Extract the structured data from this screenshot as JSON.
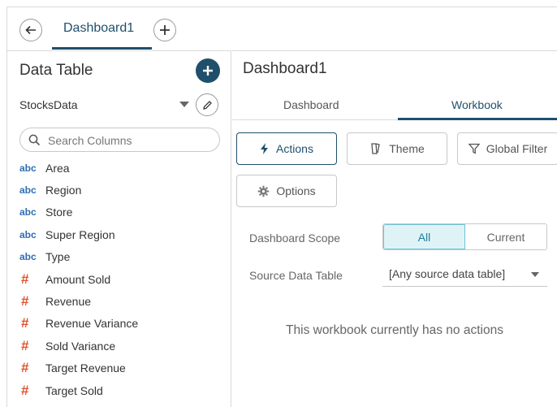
{
  "top_tabs": {
    "active_tab": "Dashboard1"
  },
  "left_panel": {
    "title": "Data Table",
    "data_source": "StocksData",
    "search_placeholder": "Search Columns",
    "fields": [
      {
        "type": "abc",
        "label": "Area"
      },
      {
        "type": "abc",
        "label": "Region"
      },
      {
        "type": "abc",
        "label": "Store"
      },
      {
        "type": "abc",
        "label": "Super Region"
      },
      {
        "type": "abc",
        "label": "Type"
      },
      {
        "type": "#",
        "label": "Amount Sold"
      },
      {
        "type": "#",
        "label": "Revenue"
      },
      {
        "type": "#",
        "label": "Revenue Variance"
      },
      {
        "type": "#",
        "label": "Sold Variance"
      },
      {
        "type": "#",
        "label": "Target Revenue"
      },
      {
        "type": "#",
        "label": "Target Sold"
      }
    ]
  },
  "right_panel": {
    "title": "Dashboard1",
    "subtabs": {
      "dashboard": "Dashboard",
      "workbook": "Workbook"
    },
    "buttons": {
      "actions": "Actions",
      "theme": "Theme",
      "global_filter": "Global Filter",
      "options": "Options"
    },
    "scope": {
      "label": "Dashboard Scope",
      "all": "All",
      "current": "Current",
      "selected": "All"
    },
    "source": {
      "label": "Source Data Table",
      "value": "[Any source data table]"
    },
    "empty_message": "This workbook currently has no actions"
  },
  "colors": {
    "accent": "#1f4f6b",
    "abc_type": "#2e6db3",
    "numeric_type": "#e0542c",
    "segment_selected_bg": "#dff3f7"
  }
}
